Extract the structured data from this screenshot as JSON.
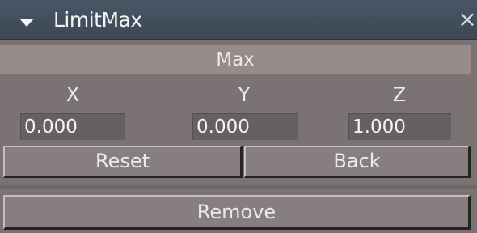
{
  "panel": {
    "title": "LimitMax",
    "close_label": "×",
    "section_header": "Max",
    "axes": [
      {
        "label": "X",
        "value": "0.000"
      },
      {
        "label": "Y",
        "value": "0.000"
      },
      {
        "label": "Z",
        "value": "1.000"
      }
    ],
    "buttons": {
      "reset": "Reset",
      "back": "Back",
      "remove": "Remove"
    }
  },
  "colors": {
    "titlebar": "#3d4856",
    "panel_bg": "#7b7373",
    "header_bg": "#958b8b",
    "field_bg": "#676060",
    "button_bg": "#877f7f"
  },
  "icons": {
    "collapse": "triangle-down-icon",
    "close": "close-icon"
  }
}
